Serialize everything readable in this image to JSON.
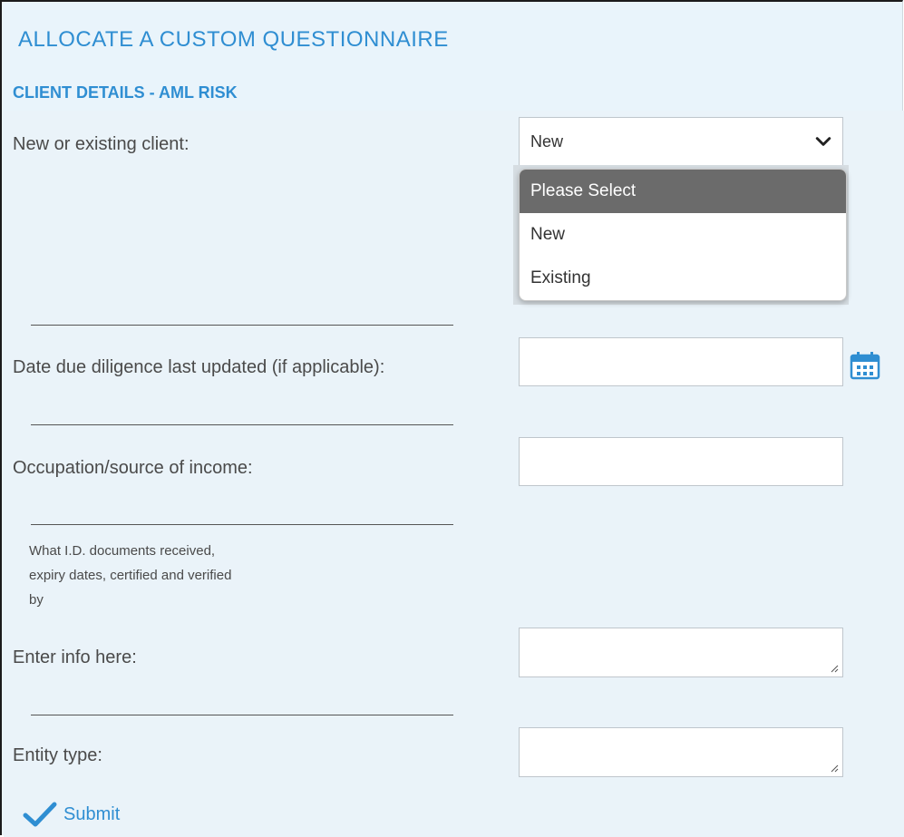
{
  "page": {
    "title": "ALLOCATE A CUSTOM QUESTIONNAIRE",
    "subtitle": "CLIENT DETAILS - AML RISK"
  },
  "fields": {
    "client_type": {
      "label": "New or existing client:",
      "selected": "New",
      "options": [
        "Please Select",
        "New",
        "Existing"
      ],
      "highlighted_option": "Please Select"
    },
    "due_diligence_date": {
      "label": "Date due diligence last updated (if applicable):",
      "value": ""
    },
    "occupation": {
      "label": "Occupation/source of income:",
      "value": ""
    },
    "id_documents": {
      "help_text": "What I.D. documents received,\nexpiry dates, certified and verified\nby",
      "label": "Enter info here:",
      "value": ""
    },
    "entity_type": {
      "label": "Entity type:",
      "value": ""
    }
  },
  "actions": {
    "submit_label": "Submit"
  },
  "colors": {
    "accent": "#2f8ed2",
    "background": "#e9f4fb",
    "dropdown_highlight": "#6b6b6b"
  },
  "icons": {
    "chevron": "chevron-down-icon",
    "calendar": "calendar-icon",
    "submit": "checkmark-icon"
  }
}
